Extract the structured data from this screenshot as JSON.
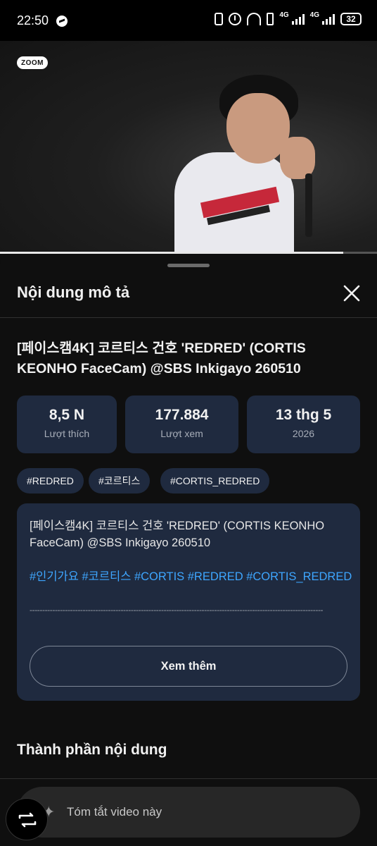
{
  "status_bar": {
    "time": "22:50",
    "network_1": "4G",
    "network_2": "4G",
    "battery": "32"
  },
  "video": {
    "watermark": "ZOOM",
    "progress": 0.91
  },
  "sheet": {
    "title": "Nội dung mô tả",
    "video_title": "[페이스캠4K] 코르티스 건호 'REDRED' (CORTIS KEONHO FaceCam) @SBS Inkigayo 260510",
    "stats": [
      {
        "value": "8,5 N",
        "label": "Lượt thích"
      },
      {
        "value": "177.884",
        "label": "Lượt xem"
      },
      {
        "value": "13 thg 5",
        "label": "2026"
      }
    ],
    "tags": [
      "#REDRED",
      "#코르티스",
      "#CORTIS_REDRED"
    ],
    "description": {
      "text": "[페이스캠4K] 코르티스 건호 'REDRED' (CORTIS KEONHO FaceCam) @SBS Inkigayo 260510",
      "hashtags": "#인기가요 #코르티스 #CORTIS #REDRED #CORTIS_REDRED",
      "separator": "--------------------------------------------------------------------------------------------------------------------",
      "more_label": "Xem thêm"
    },
    "section_title": "Thành phần nội dung",
    "ask_placeholder": "Tóm tắt video này"
  },
  "colors": {
    "background": "#0f0f0f",
    "card": "#1f2a3f",
    "hashtag": "#3ea6ff"
  }
}
